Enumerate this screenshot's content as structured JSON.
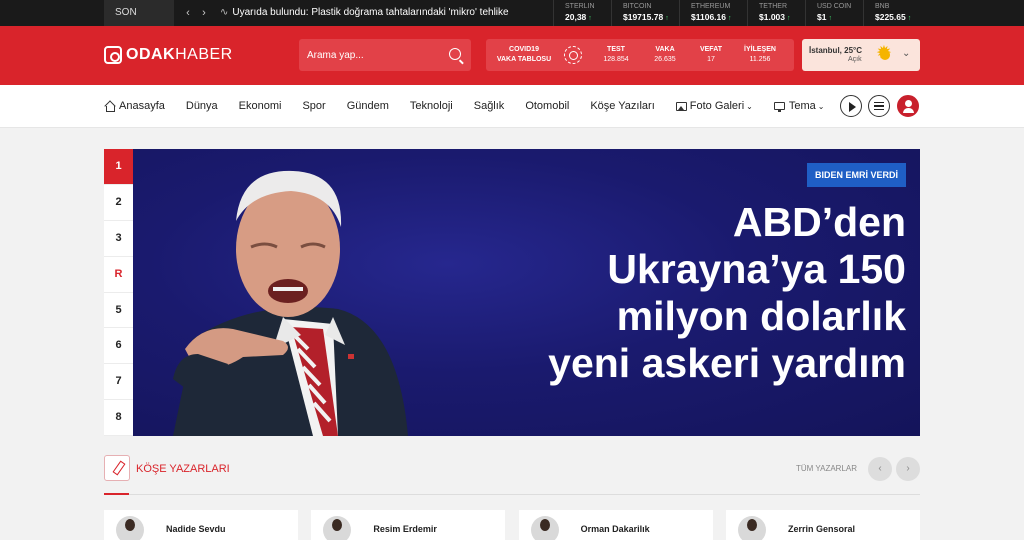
{
  "ticker": {
    "label": "SON DAKİKA",
    "prev": "‹",
    "next": "›",
    "headline": "Uyarıda bulundu: Plastik doğrama tahtalarındaki 'mikro' tehlike"
  },
  "quotes": [
    {
      "name": "STERLIN",
      "value": "20,38",
      "trend": "↑"
    },
    {
      "name": "BITCOIN",
      "value": "$19715.78",
      "trend": "↑"
    },
    {
      "name": "ETHEREUM",
      "value": "$1106.16",
      "trend": "↑"
    },
    {
      "name": "TETHER",
      "value": "$1.003",
      "trend": "↑"
    },
    {
      "name": "USD COIN",
      "value": "$1",
      "trend": "↑"
    },
    {
      "name": "BNB",
      "value": "$225.65",
      "trend": "↑"
    }
  ],
  "header": {
    "logo_bold": "ODAK",
    "logo_light": "HABER",
    "search_placeholder": "Arama yap...",
    "covid_title_1": "COVID19",
    "covid_title_2": "VAKA TABLOSU",
    "stats": [
      {
        "label": "TEST",
        "value": "128.854"
      },
      {
        "label": "VAKA",
        "value": "26.635"
      },
      {
        "label": "VEFAT",
        "value": "17"
      },
      {
        "label": "İYİLEŞEN",
        "value": "11.256"
      }
    ],
    "weather_city": "İstanbul, 25°C",
    "weather_desc": "Açık",
    "weather_caret": "⌄"
  },
  "nav": {
    "items": [
      "Anasayfa",
      "Dünya",
      "Ekonomi",
      "Spor",
      "Gündem",
      "Teknoloji",
      "Sağlık",
      "Otomobil",
      "Köşe Yazıları",
      "Foto Galeri",
      "Tema"
    ]
  },
  "slider": {
    "numbers": [
      "1",
      "2",
      "3",
      "R",
      "5",
      "6",
      "7",
      "8"
    ],
    "badge": "BIDEN EMRİ VERDİ",
    "title": "ABD’den Ukrayna’ya 150 milyon dolarlık yeni askeri yardım"
  },
  "section": {
    "title": "KÖŞE YAZARLARI",
    "all_link": "TÜM YAZARLAR",
    "prev": "‹",
    "next": "›"
  },
  "authors": [
    "Nadide Sevdu",
    "Resim Erdemir",
    "Orman Dakarilık",
    "Zerrin Gensoral"
  ],
  "colors": {
    "brand_red": "#d9242b",
    "accent_blue": "#1f5ec5",
    "up_green": "#3ecf6a"
  }
}
